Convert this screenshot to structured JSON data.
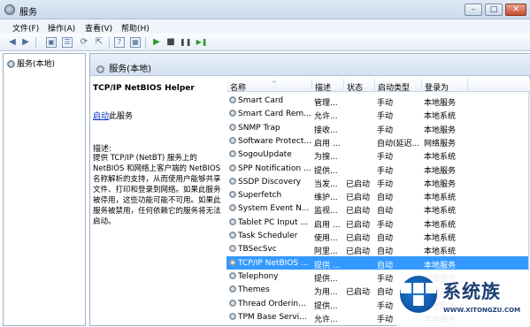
{
  "window": {
    "title": "服务",
    "min_label": "–",
    "max_label": "□",
    "close_label": "✕"
  },
  "menu": [
    "文件(F)",
    "操作(A)",
    "查看(V)",
    "帮助(H)"
  ],
  "toolbar": {
    "back": "◀",
    "forward": "▶",
    "console": "▣",
    "list": "☰",
    "refresh": "⟳",
    "export": "⇱",
    "help": "?",
    "properties": "▦",
    "start": "▶",
    "stop": "■",
    "pause": "❚❚",
    "restart": "▶❚"
  },
  "tree": {
    "item": "服务(本地)"
  },
  "main": {
    "header": "服务(本地)"
  },
  "detail": {
    "service_name": "TCP/IP NetBIOS Helper",
    "start_link": "启动",
    "start_suffix": "此服务",
    "desc_label": "描述:",
    "desc_text": "提供 TCP/IP (NetBT) 服务上的 NetBIOS 和网络上客户端的 NetBIOS 名称解析的支持，从而使用户能够共享文件、打印和登录到网络。如果此服务被停用，这些功能可能不可用。如果此服务被禁用，任何依赖它的服务将无法启动。"
  },
  "columns": [
    "名称",
    "描述",
    "状态",
    "启动类型",
    "登录为"
  ],
  "services": [
    {
      "name": "Smart Card",
      "desc": "管理...",
      "status": "",
      "startup": "手动",
      "logon": "本地服务"
    },
    {
      "name": "Smart Card Rem...",
      "desc": "允许...",
      "status": "",
      "startup": "手动",
      "logon": "本地系统"
    },
    {
      "name": "SNMP Trap",
      "desc": "接收...",
      "status": "",
      "startup": "手动",
      "logon": "本地服务"
    },
    {
      "name": "Software Protect...",
      "desc": "启用 ...",
      "status": "",
      "startup": "自动(延迟...",
      "logon": "网络服务"
    },
    {
      "name": "SogouUpdate",
      "desc": "为搜...",
      "status": "",
      "startup": "手动",
      "logon": "本地系统"
    },
    {
      "name": "SPP Notification ...",
      "desc": "提供...",
      "status": "",
      "startup": "手动",
      "logon": "本地服务"
    },
    {
      "name": "SSDP Discovery",
      "desc": "当发...",
      "status": "已启动",
      "startup": "手动",
      "logon": "本地服务"
    },
    {
      "name": "Superfetch",
      "desc": "维护...",
      "status": "已启动",
      "startup": "自动",
      "logon": "本地系统"
    },
    {
      "name": "System Event N...",
      "desc": "监视...",
      "status": "已启动",
      "startup": "自动",
      "logon": "本地系统"
    },
    {
      "name": "Tablet PC Input ...",
      "desc": "启用 ...",
      "status": "已启动",
      "startup": "手动",
      "logon": "本地系统"
    },
    {
      "name": "Task Scheduler",
      "desc": "使用...",
      "status": "已启动",
      "startup": "自动",
      "logon": "本地系统"
    },
    {
      "name": "TBSecSvc",
      "desc": "阿里...",
      "status": "已启动",
      "startup": "自动",
      "logon": "本地系统"
    },
    {
      "name": "TCP/IP NetBIOS ...",
      "desc": "提供 ...",
      "status": "",
      "startup": "自动",
      "logon": "本地服务"
    },
    {
      "name": "Telephony",
      "desc": "提供...",
      "status": "",
      "startup": "手动",
      "logon": "网络服务"
    },
    {
      "name": "Themes",
      "desc": "为用...",
      "status": "已启动",
      "startup": "自动",
      "logon": "本地系统"
    },
    {
      "name": "Thread Orderin...",
      "desc": "提供...",
      "status": "",
      "startup": "手动",
      "logon": "本地服务"
    },
    {
      "name": "TPM Base Servi...",
      "desc": "允许...",
      "status": "",
      "startup": "手动",
      "logon": "本地服务"
    }
  ],
  "selected_index": 12,
  "brand": {
    "name": "系统族",
    "url": "WWW.XITONGZU.COM"
  },
  "colors": {
    "selection": "#3399ff",
    "link": "#0033cc"
  }
}
